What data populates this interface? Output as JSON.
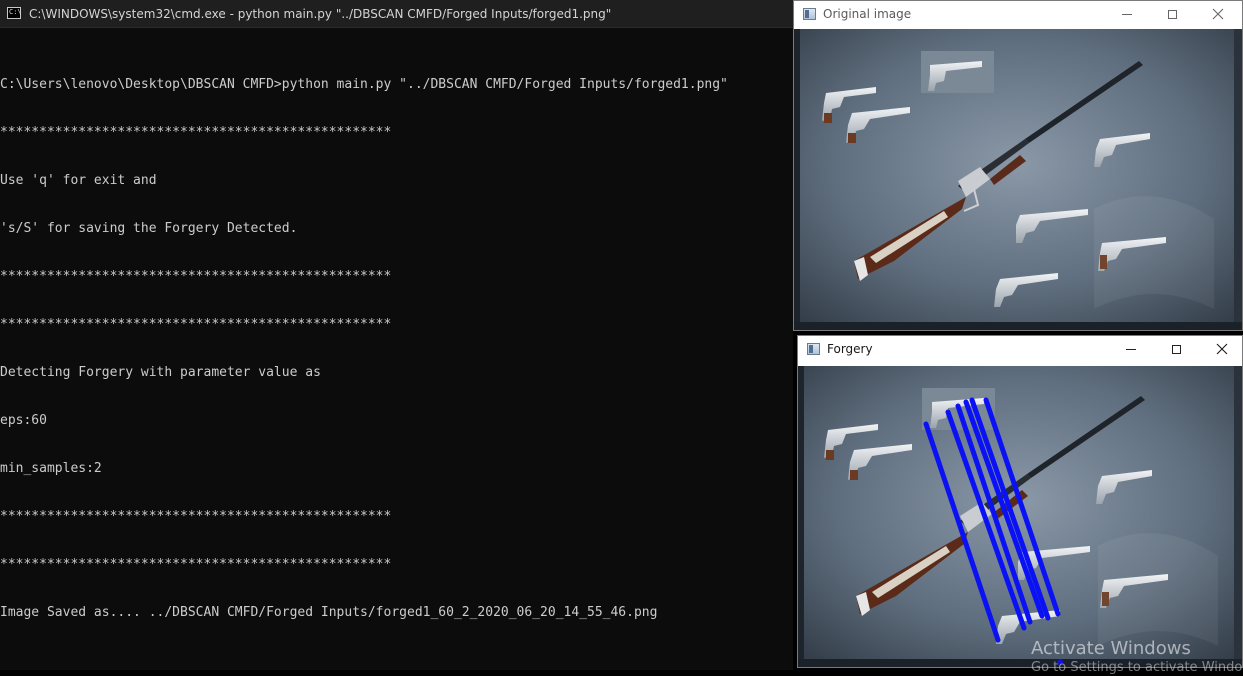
{
  "console": {
    "title": "C:\\WINDOWS\\system32\\cmd.exe - python  main.py \"../DBSCAN CMFD/Forged Inputs/forged1.png\"",
    "icon": "cmd-icon",
    "lines": [
      "C:\\Users\\lenovo\\Desktop\\DBSCAN CMFD>python main.py \"../DBSCAN CMFD/Forged Inputs/forged1.png\"",
      "**************************************************",
      "Use 'q' for exit and",
      "'s/S' for saving the Forgery Detected.",
      "**************************************************",
      "**************************************************",
      "Detecting Forgery with parameter value as",
      "eps:60",
      "min_samples:2",
      "**************************************************",
      "**************************************************",
      "Image Saved as.... ../DBSCAN CMFD/Forged Inputs/forged1_60_2_2020_06_20_14_55_46.png"
    ]
  },
  "original_window": {
    "title": "Original image",
    "icon": "app-window-icon"
  },
  "forgery_window": {
    "title": "Forgery",
    "icon": "app-window-icon",
    "match_line_color": "#0a12f5"
  },
  "watermark": {
    "title": "Activate Windows",
    "subtitle": "Go to Settings to activate Windows."
  }
}
